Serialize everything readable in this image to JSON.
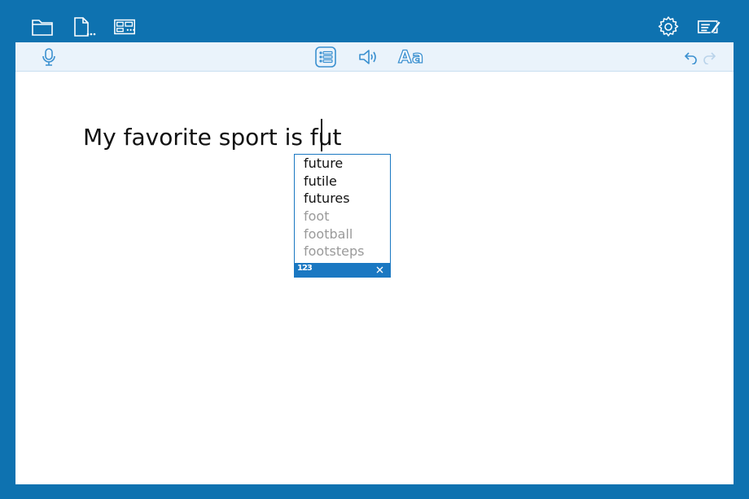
{
  "topbar": {
    "left_icons": [
      "folder-icon",
      "new-document-icon",
      "word-bank-icon"
    ],
    "right_icons": [
      "settings-gear-icon",
      "edit-list-icon"
    ]
  },
  "toolbar": {
    "icons": [
      "microphone-icon",
      "prediction-list-icon",
      "speaker-icon",
      "undo-icon",
      "redo-icon"
    ],
    "font_label": "Aa"
  },
  "document": {
    "text": "My favorite sport is fut"
  },
  "suggestions": {
    "items": [
      {
        "word": "future",
        "dim": false
      },
      {
        "word": "futile",
        "dim": false
      },
      {
        "word": "futures",
        "dim": false
      },
      {
        "word": "foot",
        "dim": true
      },
      {
        "word": "football",
        "dim": true
      },
      {
        "word": "footsteps",
        "dim": true
      }
    ],
    "numbers_label": "123"
  },
  "colors": {
    "frame": "#0e72b0",
    "toolbar_bg": "#eaf3fb",
    "accent": "#1a78c2",
    "dim_text": "#9a9a9a"
  }
}
